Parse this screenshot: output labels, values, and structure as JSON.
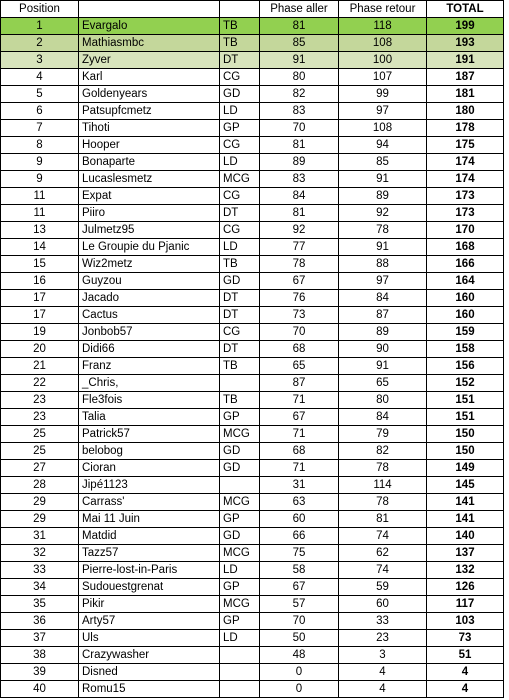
{
  "header": {
    "position": "Position",
    "name": "",
    "poste": "",
    "phase_aller": "Phase aller",
    "phase_retour": "Phase retour",
    "total": "TOTAL"
  },
  "highlight_colors": {
    "first": "#92d050",
    "second": "#c4d79b",
    "third": "#d8e4bc"
  },
  "rows": [
    {
      "position": "1",
      "name": "Evargalo",
      "poste": "TB",
      "aller": "81",
      "retour": "118",
      "total": "199"
    },
    {
      "position": "2",
      "name": "Mathiasmbc",
      "poste": "TB",
      "aller": "85",
      "retour": "108",
      "total": "193"
    },
    {
      "position": "3",
      "name": "Zyver",
      "poste": "DT",
      "aller": "91",
      "retour": "100",
      "total": "191"
    },
    {
      "position": "4",
      "name": "Karl",
      "poste": "CG",
      "aller": "80",
      "retour": "107",
      "total": "187"
    },
    {
      "position": "5",
      "name": "Goldenyears",
      "poste": "GD",
      "aller": "82",
      "retour": "99",
      "total": "181"
    },
    {
      "position": "6",
      "name": "Patsupfcmetz",
      "poste": "LD",
      "aller": "83",
      "retour": "97",
      "total": "180"
    },
    {
      "position": "7",
      "name": "Tihoti",
      "poste": "GP",
      "aller": "70",
      "retour": "108",
      "total": "178"
    },
    {
      "position": "8",
      "name": "Hooper",
      "poste": "CG",
      "aller": "81",
      "retour": "94",
      "total": "175"
    },
    {
      "position": "9",
      "name": "Bonaparte",
      "poste": "LD",
      "aller": "89",
      "retour": "85",
      "total": "174"
    },
    {
      "position": "9",
      "name": "Lucaslesmetz",
      "poste": "MCG",
      "aller": "83",
      "retour": "91",
      "total": "174"
    },
    {
      "position": "11",
      "name": "Expat",
      "poste": "CG",
      "aller": "84",
      "retour": "89",
      "total": "173"
    },
    {
      "position": "11",
      "name": "Piiro",
      "poste": "DT",
      "aller": "81",
      "retour": "92",
      "total": "173"
    },
    {
      "position": "13",
      "name": "Julmetz95",
      "poste": "CG",
      "aller": "92",
      "retour": "78",
      "total": "170"
    },
    {
      "position": "14",
      "name": "Le Groupie du Pjanic",
      "poste": "LD",
      "aller": "77",
      "retour": "91",
      "total": "168"
    },
    {
      "position": "15",
      "name": "Wiz2metz",
      "poste": "TB",
      "aller": "78",
      "retour": "88",
      "total": "166"
    },
    {
      "position": "16",
      "name": "Guyzou",
      "poste": "GD",
      "aller": "67",
      "retour": "97",
      "total": "164"
    },
    {
      "position": "17",
      "name": "Jacado",
      "poste": "DT",
      "aller": "76",
      "retour": "84",
      "total": "160"
    },
    {
      "position": "17",
      "name": "Cactus",
      "poste": "DT",
      "aller": "73",
      "retour": "87",
      "total": "160"
    },
    {
      "position": "19",
      "name": "Jonbob57",
      "poste": "CG",
      "aller": "70",
      "retour": "89",
      "total": "159"
    },
    {
      "position": "20",
      "name": "Didi66",
      "poste": "DT",
      "aller": "68",
      "retour": "90",
      "total": "158"
    },
    {
      "position": "21",
      "name": "Franz",
      "poste": "TB",
      "aller": "65",
      "retour": "91",
      "total": "156"
    },
    {
      "position": "22",
      "name": "_Chris,",
      "poste": "",
      "aller": "87",
      "retour": "65",
      "total": "152"
    },
    {
      "position": "23",
      "name": "Fle3fois",
      "poste": "TB",
      "aller": "71",
      "retour": "80",
      "total": "151"
    },
    {
      "position": "23",
      "name": "Talia",
      "poste": "GP",
      "aller": "67",
      "retour": "84",
      "total": "151"
    },
    {
      "position": "25",
      "name": "Patrick57",
      "poste": "MCG",
      "aller": "71",
      "retour": "79",
      "total": "150"
    },
    {
      "position": "25",
      "name": "belobog",
      "poste": "GD",
      "aller": "68",
      "retour": "82",
      "total": "150"
    },
    {
      "position": "27",
      "name": "Cioran",
      "poste": "GD",
      "aller": "71",
      "retour": "78",
      "total": "149"
    },
    {
      "position": "28",
      "name": "Jipé1123",
      "poste": "",
      "aller": "31",
      "retour": "114",
      "total": "145"
    },
    {
      "position": "29",
      "name": "Carrass'",
      "poste": "MCG",
      "aller": "63",
      "retour": "78",
      "total": "141"
    },
    {
      "position": "29",
      "name": "Mai 11 Juin",
      "poste": "GP",
      "aller": "60",
      "retour": "81",
      "total": "141"
    },
    {
      "position": "31",
      "name": "Matdid",
      "poste": "GD",
      "aller": "66",
      "retour": "74",
      "total": "140"
    },
    {
      "position": "32",
      "name": "Tazz57",
      "poste": "MCG",
      "aller": "75",
      "retour": "62",
      "total": "137"
    },
    {
      "position": "33",
      "name": "Pierre-lost-in-Paris",
      "poste": "LD",
      "aller": "58",
      "retour": "74",
      "total": "132"
    },
    {
      "position": "34",
      "name": "Sudouestgrenat",
      "poste": "GP",
      "aller": "67",
      "retour": "59",
      "total": "126"
    },
    {
      "position": "35",
      "name": "Pikir",
      "poste": "MCG",
      "aller": "57",
      "retour": "60",
      "total": "117"
    },
    {
      "position": "36",
      "name": "Arty57",
      "poste": "GP",
      "aller": "70",
      "retour": "33",
      "total": "103"
    },
    {
      "position": "37",
      "name": "Uls",
      "poste": "LD",
      "aller": "50",
      "retour": "23",
      "total": "73"
    },
    {
      "position": "38",
      "name": "Crazywasher",
      "poste": "",
      "aller": "48",
      "retour": "3",
      "total": "51"
    },
    {
      "position": "39",
      "name": "Disned",
      "poste": "",
      "aller": "0",
      "retour": "4",
      "total": "4"
    },
    {
      "position": "40",
      "name": "Romu15",
      "poste": "",
      "aller": "0",
      "retour": "4",
      "total": "4"
    }
  ]
}
